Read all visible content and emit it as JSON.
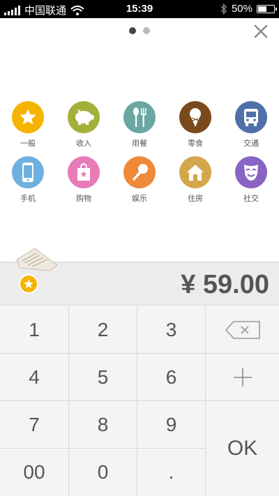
{
  "status_bar": {
    "carrier": "中国联通",
    "time": "15:39",
    "battery_percent": "50%",
    "battery_level": 0.5,
    "icons": [
      "signal-icon",
      "wifi-icon",
      "bluetooth-icon",
      "battery-icon"
    ]
  },
  "pager": {
    "pages": 2,
    "current": 1
  },
  "categories": [
    {
      "label": "一般",
      "icon": "star-icon",
      "color": "#f5b400"
    },
    {
      "label": "收入",
      "icon": "piggy-bank-icon",
      "color": "#a3b13b"
    },
    {
      "label": "用餐",
      "icon": "utensils-icon",
      "color": "#6aa7a3"
    },
    {
      "label": "零食",
      "icon": "ice-cream-icon",
      "color": "#7a4a1c"
    },
    {
      "label": "交通",
      "icon": "bus-icon",
      "color": "#4f6fa8"
    },
    {
      "label": "手机",
      "icon": "phone-icon",
      "color": "#6fb0e0"
    },
    {
      "label": "购物",
      "icon": "shopping-bag-icon",
      "color": "#e77bb8"
    },
    {
      "label": "娱乐",
      "icon": "microphone-icon",
      "color": "#ee8a3a"
    },
    {
      "label": "住房",
      "icon": "house-icon",
      "color": "#d3a74a"
    },
    {
      "label": "社交",
      "icon": "mask-icon",
      "color": "#8a64c4"
    }
  ],
  "amount": {
    "display": "¥ 59.00"
  },
  "selected_category_icon": "star-icon",
  "keypad": {
    "keys": [
      "1",
      "2",
      "3",
      "4",
      "5",
      "6",
      "7",
      "8",
      "9",
      "00",
      "0",
      "."
    ],
    "backspace_icon": "backspace-icon",
    "plus_icon": "plus-icon",
    "ok_label": "OK"
  }
}
